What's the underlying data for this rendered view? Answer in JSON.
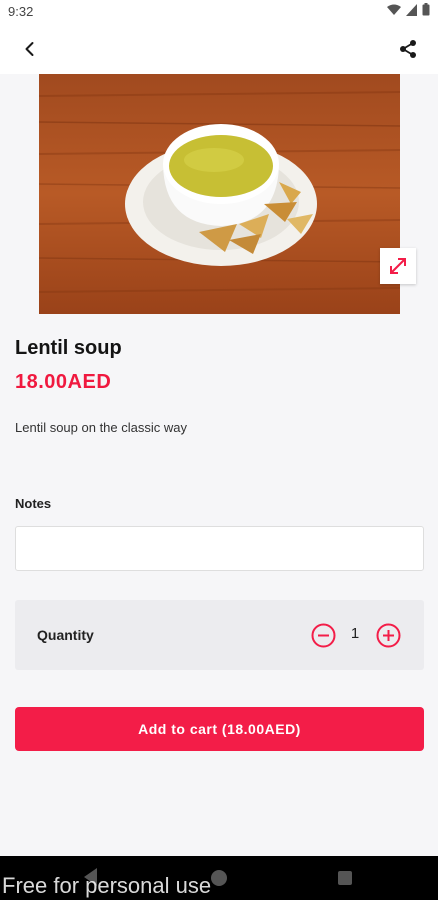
{
  "status_bar": {
    "time": "9:32"
  },
  "item": {
    "name": "Lentil soup",
    "price": "18.00AED",
    "description": "Lentil soup on the classic way"
  },
  "notes": {
    "label": "Notes",
    "value": "",
    "placeholder": ""
  },
  "quantity": {
    "label": "Quantity",
    "value": "1"
  },
  "cart": {
    "add_label": "Add to cart (18.00AED)"
  },
  "watermark": "Free for personal use",
  "icons": {
    "back": "arrow-back-icon",
    "share": "share-icon",
    "expand": "expand-icon",
    "minus": "minus-circle-icon",
    "plus": "plus-circle-icon"
  },
  "colors": {
    "accent": "#f31d48",
    "price": "#f0193f",
    "background": "#f6f6f8"
  }
}
